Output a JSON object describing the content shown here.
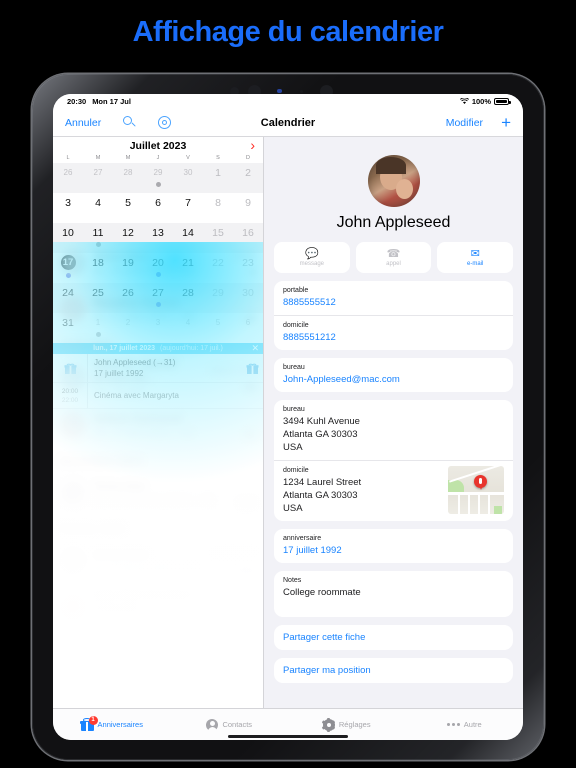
{
  "headline": "Affichage du calendrier",
  "status_bar": {
    "time": "20:30",
    "date": "Mon 17 Jul",
    "battery": "100%",
    "wifi_icon": "wifi-icon"
  },
  "navbar": {
    "cancel": "Annuler",
    "search_icon": "search-icon",
    "settings_icon": "gear-icon",
    "title": "Calendrier",
    "edit": "Modifier",
    "add": "+"
  },
  "calendar": {
    "month": "Juillet 2023",
    "next_icon": "chevron-right-icon",
    "day_headers": [
      "L",
      "M",
      "M",
      "J",
      "V",
      "S",
      "D"
    ],
    "weeks": [
      [
        {
          "n": "26",
          "dim": true
        },
        {
          "n": "27",
          "dim": true
        },
        {
          "n": "28",
          "dim": true
        },
        {
          "n": "29",
          "dim": true,
          "dot": "gray"
        },
        {
          "n": "30",
          "dim": true
        },
        {
          "n": "1",
          "weekend": true
        },
        {
          "n": "2",
          "weekend": true
        }
      ],
      [
        {
          "n": "3"
        },
        {
          "n": "4"
        },
        {
          "n": "5"
        },
        {
          "n": "6"
        },
        {
          "n": "7"
        },
        {
          "n": "8",
          "weekend": true
        },
        {
          "n": "9",
          "weekend": true
        }
      ],
      [
        {
          "n": "10"
        },
        {
          "n": "11",
          "dot": "gray"
        },
        {
          "n": "12"
        },
        {
          "n": "13"
        },
        {
          "n": "14"
        },
        {
          "n": "15",
          "weekend": true
        },
        {
          "n": "16",
          "weekend": true
        }
      ],
      [
        {
          "n": "17",
          "today": true,
          "dot": "blue"
        },
        {
          "n": "18"
        },
        {
          "n": "19"
        },
        {
          "n": "20",
          "dot": "blue"
        },
        {
          "n": "21"
        },
        {
          "n": "22",
          "weekend": true
        },
        {
          "n": "23",
          "weekend": true
        }
      ],
      [
        {
          "n": "24"
        },
        {
          "n": "25"
        },
        {
          "n": "26"
        },
        {
          "n": "27",
          "dot": "blue"
        },
        {
          "n": "28"
        },
        {
          "n": "29",
          "weekend": true
        },
        {
          "n": "30",
          "weekend": true
        }
      ],
      [
        {
          "n": "31"
        },
        {
          "n": "1",
          "dim": true,
          "dot": "gray"
        },
        {
          "n": "2",
          "dim": true
        },
        {
          "n": "3",
          "dim": true
        },
        {
          "n": "4",
          "dim": true
        },
        {
          "n": "5",
          "dim": true
        },
        {
          "n": "6",
          "dim": true
        }
      ]
    ]
  },
  "event_list": {
    "header_date": "lun., 17 juillet 2023",
    "header_today": "(aujourd'hui: 17 juil.)",
    "close_icon": "close-icon",
    "events": [
      {
        "kind": "birthday",
        "icon": "gift-icon",
        "line1": "John Appleseed (→31)",
        "line2": "17 juillet 1992",
        "trailing_icon": "gift-icon"
      },
      {
        "kind": "timed",
        "start": "20:00",
        "end": "22:00",
        "title": "Cinéma avec Margaryta"
      }
    ]
  },
  "birthday_list_blurred": {
    "sections": [
      {
        "title": "",
        "rows": [
          {
            "name": "Anna Haro",
            "date": "jeu. 20 juillet 2000 (→23)",
            "tag": "Famille",
            "num": "3"
          },
          {
            "name": "Paradise Easton",
            "date": "jeu. 27 juillet 2005 (→18)",
            "tag": "",
            "num": "10"
          }
        ]
      },
      {
        "title": "Août 2023",
        "rows": [
          {
            "name": "Hank M. Zakroff (Financial...",
            "date": "mer. 16 août",
            "tag": "Affaires, Amis",
            "num": "30"
          },
          {
            "name": "Selena Garmond",
            "date": "dim. 27 août 2002 (→21)",
            "tag": "",
            "num": "41"
          }
        ]
      },
      {
        "title": "Novembre 2023",
        "rows": [
          {
            "name": "Anna Gee",
            "date": "jeu. 30 novembre 2000 (→23)",
            "tag": "",
            "num": "136"
          }
        ]
      },
      {
        "title": "Février 2024",
        "rows": [
          {
            "name": "Anna Haro",
            "date": "jeu. 15 février 2002 (→22)",
            "tag": "Famille, Fête",
            "num": "213"
          },
          {
            "name": "Kate Bell (Creative Consulti...",
            "date": "mar. 20 février 1995 (→29)",
            "tag": "Affaires",
            "num": "218"
          }
        ]
      },
      {
        "title": "Juin 2024",
        "rows": [
          {
            "name": "David Taylor",
            "date": "",
            "tag": "Amis",
            "num": "334"
          }
        ]
      }
    ]
  },
  "contact": {
    "avatar": "contact-avatar",
    "name": "John Appleseed",
    "actions": [
      {
        "label": "message",
        "icon": "message-icon",
        "enabled": false
      },
      {
        "label": "appel",
        "icon": "phone-icon",
        "enabled": false
      },
      {
        "label": "e-mail",
        "icon": "mail-icon",
        "enabled": true
      }
    ],
    "phones": [
      {
        "label": "portable",
        "value": "8885555512"
      },
      {
        "label": "domicile",
        "value": "8885551212"
      }
    ],
    "emails": [
      {
        "label": "bureau",
        "value": "John-Appleseed@mac.com"
      }
    ],
    "addresses": [
      {
        "label": "bureau",
        "line1": "3494 Kuhl Avenue",
        "line2": "Atlanta GA 30303",
        "line3": "USA",
        "has_map": false
      },
      {
        "label": "domicile",
        "line1": "1234 Laurel Street",
        "line2": "Atlanta GA 30303",
        "line3": "USA",
        "has_map": true,
        "map_icon": "map-pin-icon"
      }
    ],
    "birthday": {
      "label": "anniversaire",
      "value": "17 juillet 1992"
    },
    "notes": {
      "label": "Notes",
      "value": "College roommate"
    },
    "share_contact": "Partager cette fiche",
    "share_location": "Partager ma position"
  },
  "tabbar": {
    "tabs": [
      {
        "label": "Anniversaires",
        "icon": "gift-icon",
        "badge": "1",
        "active": true
      },
      {
        "label": "Contacts",
        "icon": "person-icon",
        "badge": "",
        "active": false
      },
      {
        "label": "Réglages",
        "icon": "gear-icon",
        "badge": "",
        "active": false
      },
      {
        "label": "Autre",
        "icon": "ellipsis-icon",
        "badge": "",
        "active": false
      }
    ]
  },
  "colors": {
    "accent_blue": "#1a84ff",
    "headline_blue": "#1a6dfb",
    "event_header_cyan": "#24c6f5",
    "today_dot": "#6a68e0",
    "badge_red": "#ff3b30",
    "chevron_red": "#ff2d25"
  }
}
